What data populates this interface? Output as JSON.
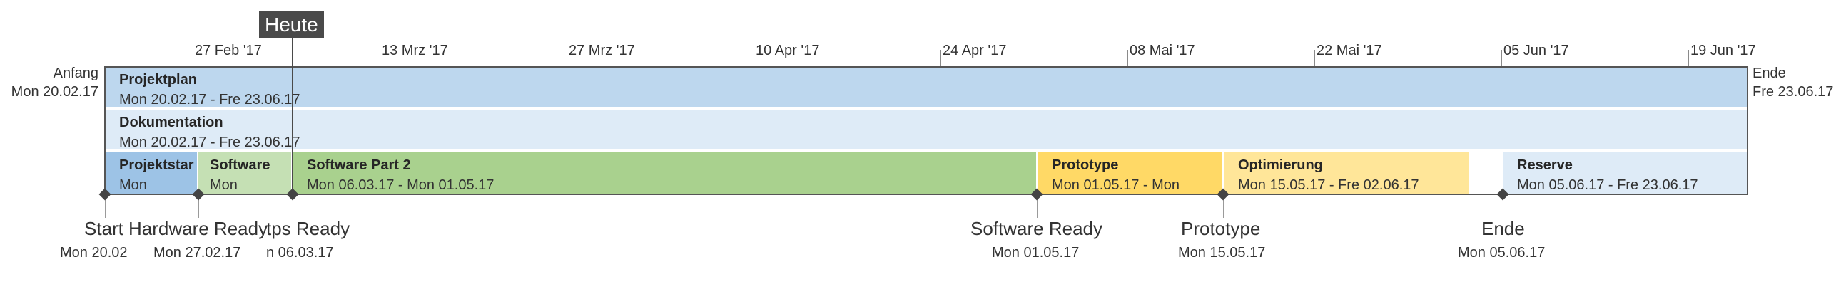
{
  "timeline": {
    "today_label": "Heute",
    "start_label": "Anfang",
    "start_date": "Mon 20.02.17",
    "end_label": "Ende",
    "end_date": "Fre 23.06.17",
    "ticks": [
      "27 Feb '17",
      "13 Mrz '17",
      "27 Mrz '17",
      "10 Apr '17",
      "24 Apr '17",
      "08 Mai '17",
      "22 Mai '17",
      "05 Jun '17",
      "19 Jun '17"
    ]
  },
  "summary_tasks": [
    {
      "title": "Projektplan",
      "dates": "Mon 20.02.17 - Fre 23.06.17",
      "color": "#bdd7ee"
    },
    {
      "title": "Dokumentation",
      "dates": "Mon 20.02.17 - Fre 23.06.17",
      "color": "#deebf7"
    }
  ],
  "tasks": [
    {
      "title": "Projektstar",
      "dates": "Mon",
      "color": "#9dc3e6"
    },
    {
      "title": "Software",
      "dates": "Mon",
      "color": "#c5e0b4"
    },
    {
      "title": "Software Part 2",
      "dates": "Mon 06.03.17 - Mon 01.05.17",
      "color": "#a9d18e"
    },
    {
      "title": "Prototype",
      "dates": "Mon 01.05.17 - Mon",
      "color": "#ffd966"
    },
    {
      "title": "Optimierung",
      "dates": "Mon 15.05.17 - Fre 02.06.17",
      "color": "#ffe699"
    },
    {
      "title": "Reserve",
      "dates": "Mon 05.06.17 - Fre 23.06.17",
      "color": "#deebf7"
    }
  ],
  "milestones": [
    {
      "name": "Start",
      "date": "Mon 20.02"
    },
    {
      "name": "Hardware Ready",
      "date": "Mon 27.02.17"
    },
    {
      "name": "tps Ready",
      "date": "n 06.03.17"
    },
    {
      "name": "Software Ready",
      "date": "Mon 01.05.17"
    },
    {
      "name": "Prototype",
      "date": "Mon 15.05.17"
    },
    {
      "name": "Ende",
      "date": "Mon 05.06.17"
    }
  ]
}
